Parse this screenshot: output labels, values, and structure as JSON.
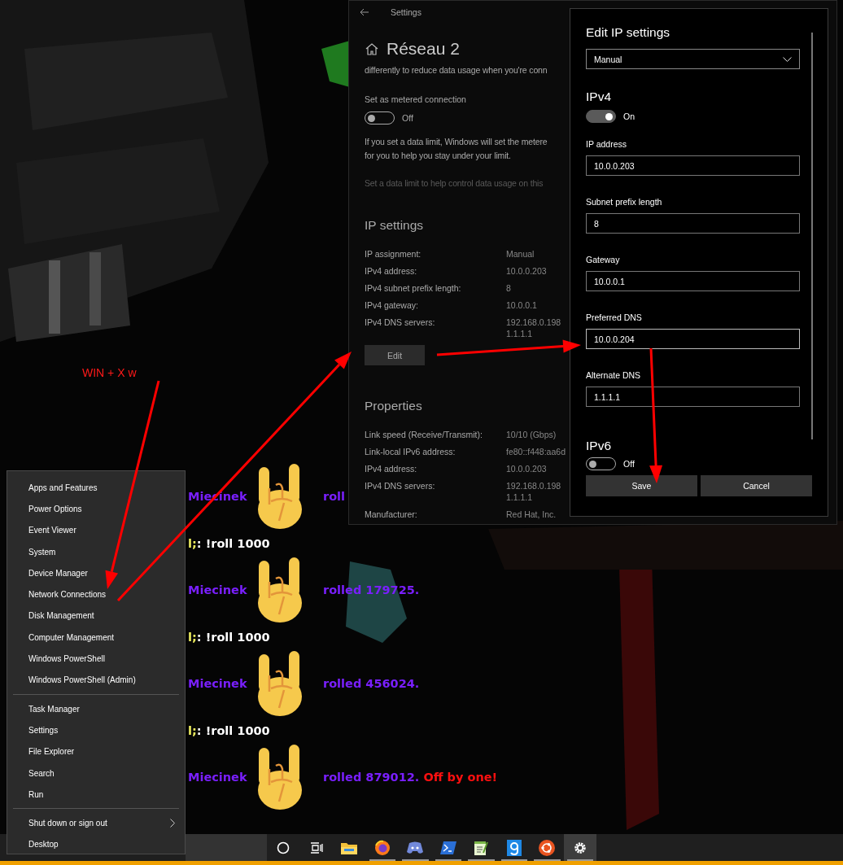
{
  "annotation": {
    "text": "WIN + X w"
  },
  "chat": [
    {
      "kind": "roll",
      "name": "Miecinek",
      "text": "roll"
    },
    {
      "kind": "command",
      "prefix": "l;",
      "text": ": !roll 1000"
    },
    {
      "kind": "roll",
      "name": "Miecinek",
      "text": "rolled 179725."
    },
    {
      "kind": "command",
      "prefix": "l;",
      "text": ": !roll 1000"
    },
    {
      "kind": "roll",
      "name": "Miecinek",
      "text": "rolled 456024."
    },
    {
      "kind": "command",
      "prefix": "l;",
      "text": ": !roll 1000"
    },
    {
      "kind": "roll",
      "name": "Miecinek",
      "text": "rolled 879012.",
      "note": "Off by one!"
    }
  ],
  "settings_window": {
    "title": "Settings",
    "page_title": "Réseau 2",
    "intro": "differently to reduce data usage when you're conn",
    "metered": {
      "label": "Set as metered connection",
      "on": false,
      "state_text": "Off"
    },
    "data_limit_text": [
      "If you set a data limit, Windows will set the metere",
      "for you to help you stay under your limit."
    ],
    "data_limit_link": "Set a data limit to help control data usage on this",
    "ip_settings": {
      "heading": "IP settings",
      "rows": [
        {
          "label": "IP assignment:",
          "values": [
            "Manual"
          ]
        },
        {
          "label": "IPv4 address:",
          "values": [
            "10.0.0.203"
          ]
        },
        {
          "label": "IPv4 subnet prefix length:",
          "values": [
            "8"
          ]
        },
        {
          "label": "IPv4 gateway:",
          "values": [
            "10.0.0.1"
          ]
        },
        {
          "label": "IPv4 DNS servers:",
          "values": [
            "192.168.0.198",
            "1.1.1.1"
          ]
        }
      ]
    },
    "edit_button": "Edit",
    "properties": {
      "heading": "Properties",
      "rows": [
        {
          "label": "Link speed (Receive/Transmit):",
          "values": [
            "10/10 (Gbps)"
          ]
        },
        {
          "label": "Link-local IPv6 address:",
          "values": [
            "fe80::f448:aa6d"
          ]
        },
        {
          "label": "IPv4 address:",
          "values": [
            "10.0.0.203"
          ]
        },
        {
          "label": "IPv4 DNS servers:",
          "values": [
            "192.168.0.198",
            "1.1.1.1"
          ]
        },
        {
          "label": "Manufacturer:",
          "values": [
            "Red Hat, Inc."
          ]
        }
      ]
    }
  },
  "edit_dialog": {
    "title": "Edit IP settings",
    "assignment": "Manual",
    "ipv4": {
      "heading": "IPv4",
      "on": true,
      "state_text": "On"
    },
    "fields": [
      {
        "label": "IP address",
        "value": "10.0.0.203",
        "focused": false
      },
      {
        "label": "Subnet prefix length",
        "value": "8",
        "focused": false
      },
      {
        "label": "Gateway",
        "value": "10.0.0.1",
        "focused": false
      },
      {
        "label": "Preferred DNS",
        "value": "10.0.0.204",
        "focused": true
      },
      {
        "label": "Alternate DNS",
        "value": "1.1.1.1",
        "focused": false
      }
    ],
    "ipv6": {
      "heading": "IPv6",
      "on": false,
      "state_text": "Off"
    },
    "buttons": [
      "Save",
      "Cancel"
    ]
  },
  "context_menu": {
    "groups": [
      [
        {
          "label": "Apps and Features",
          "submenu": false
        },
        {
          "label": "Power Options",
          "submenu": false
        },
        {
          "label": "Event Viewer",
          "submenu": false
        },
        {
          "label": "System",
          "submenu": false
        },
        {
          "label": "Device Manager",
          "submenu": false
        },
        {
          "label": "Network Connections",
          "submenu": false
        },
        {
          "label": "Disk Management",
          "submenu": false
        },
        {
          "label": "Computer Management",
          "submenu": false
        },
        {
          "label": "Windows PowerShell",
          "submenu": false
        },
        {
          "label": "Windows PowerShell (Admin)",
          "submenu": false
        }
      ],
      [
        {
          "label": "Task Manager",
          "submenu": false
        },
        {
          "label": "Settings",
          "submenu": false
        },
        {
          "label": "File Explorer",
          "submenu": false
        },
        {
          "label": "Search",
          "submenu": false
        },
        {
          "label": "Run",
          "submenu": false
        }
      ],
      [
        {
          "label": "Shut down or sign out",
          "submenu": true
        },
        {
          "label": "Desktop",
          "submenu": false
        }
      ]
    ]
  },
  "taskbar": {
    "apps": [
      {
        "kind": "cortana",
        "running": false,
        "selected": false
      },
      {
        "kind": "taskview",
        "running": false,
        "selected": false
      },
      {
        "kind": "folder",
        "running": false,
        "selected": false
      },
      {
        "kind": "browser",
        "running": true,
        "selected": false
      },
      {
        "kind": "chat",
        "running": true,
        "selected": false
      },
      {
        "kind": "terminal",
        "running": true,
        "selected": false
      },
      {
        "kind": "editor",
        "running": true,
        "selected": false
      },
      {
        "kind": "letter",
        "running": true,
        "selected": false
      },
      {
        "kind": "linux",
        "running": true,
        "selected": false
      },
      {
        "kind": "settings",
        "running": true,
        "selected": true
      }
    ]
  }
}
